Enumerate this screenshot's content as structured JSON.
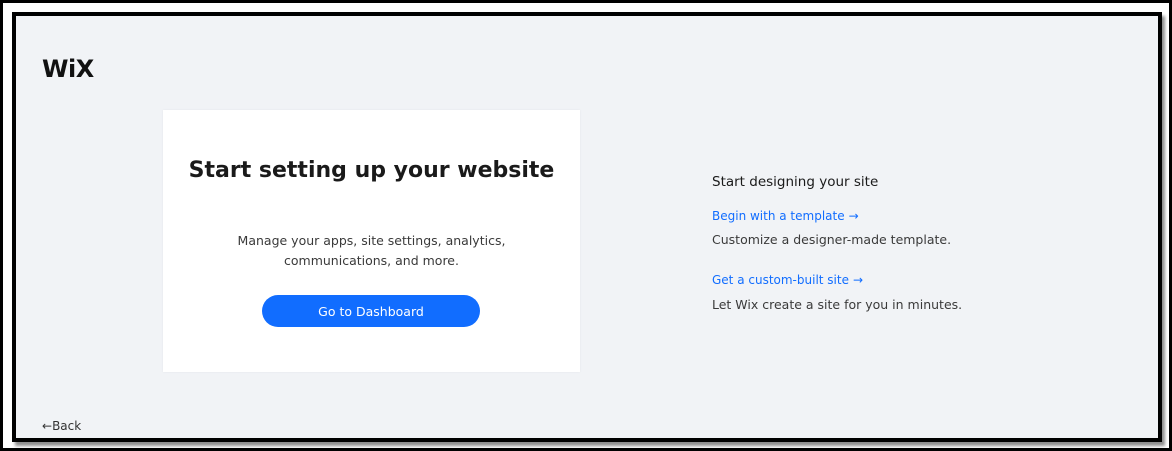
{
  "header": {
    "logo_text": "WiX"
  },
  "card": {
    "title": "Start setting up your website",
    "description": "Manage your apps, site settings, analytics, communications, and more.",
    "button_label": "Go to Dashboard"
  },
  "design": {
    "heading": "Start designing your site",
    "options": [
      {
        "link_label": "Begin with a template",
        "arrow": "→",
        "description": "Customize a designer-made template."
      },
      {
        "link_label": "Get a custom-built site",
        "arrow": "→",
        "description": "Let Wix create a site for you in minutes."
      }
    ]
  },
  "footer": {
    "back_arrow": "←",
    "back_label": "Back"
  },
  "colors": {
    "accent": "#116dff",
    "background": "#f1f3f6",
    "card": "#ffffff"
  }
}
